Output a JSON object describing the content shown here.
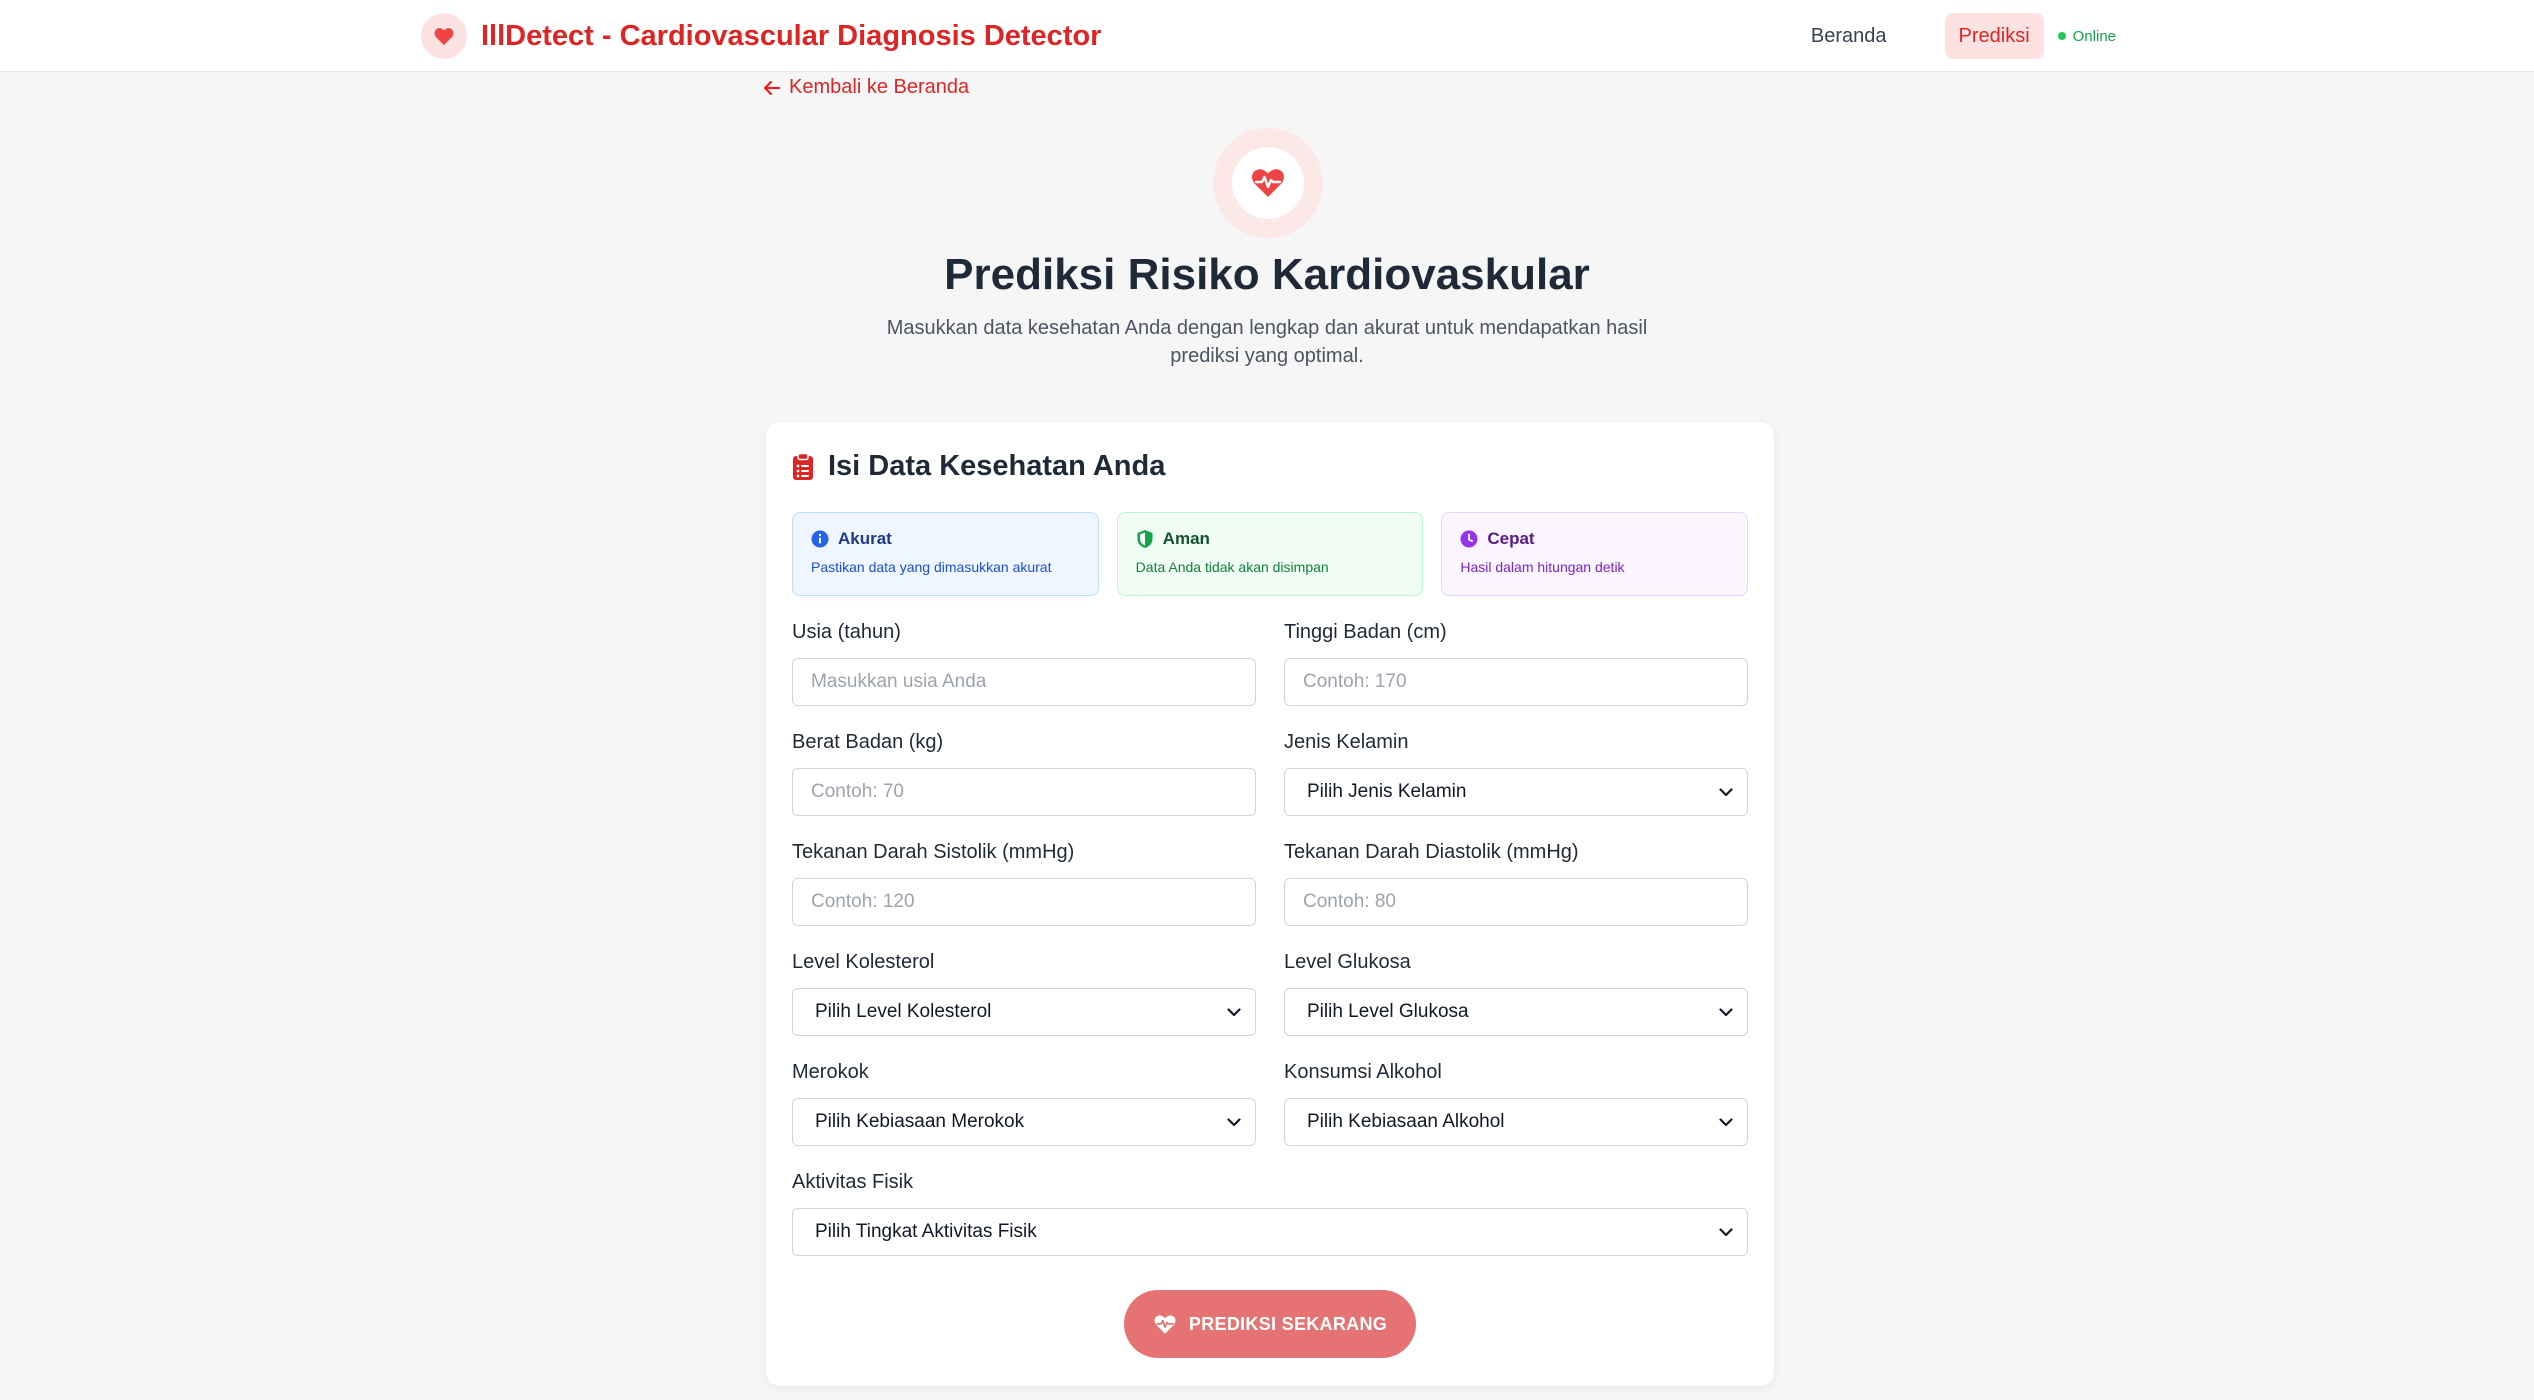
{
  "header": {
    "brand_title": "IllDetect - Cardiovascular Diagnosis Detector",
    "nav": {
      "home": "Beranda",
      "predict": "Prediksi",
      "status": "Online"
    }
  },
  "back_link": "Kembali ke Beranda",
  "hero": {
    "title": "Prediksi Risiko Kardiovaskular",
    "subtitle": "Masukkan data kesehatan Anda dengan lengkap dan akurat untuk mendapatkan hasil prediksi yang optimal."
  },
  "form": {
    "title": "Isi Data Kesehatan Anda",
    "info": [
      {
        "title": "Akurat",
        "desc": "Pastikan data yang dimasukkan akurat",
        "icon": "info-icon"
      },
      {
        "title": "Aman",
        "desc": "Data Anda tidak akan disimpan",
        "icon": "shield-icon"
      },
      {
        "title": "Cepat",
        "desc": "Hasil dalam hitungan detik",
        "icon": "clock-icon"
      }
    ],
    "fields": {
      "age": {
        "label": "Usia (tahun)",
        "placeholder": "Masukkan usia Anda"
      },
      "height": {
        "label": "Tinggi Badan (cm)",
        "placeholder": "Contoh: 170"
      },
      "weight": {
        "label": "Berat Badan (kg)",
        "placeholder": "Contoh: 70"
      },
      "gender": {
        "label": "Jenis Kelamin",
        "value": "Pilih Jenis Kelamin"
      },
      "systolic": {
        "label": "Tekanan Darah Sistolik (mmHg)",
        "placeholder": "Contoh: 120"
      },
      "diastolic": {
        "label": "Tekanan Darah Diastolik (mmHg)",
        "placeholder": "Contoh: 80"
      },
      "cholesterol": {
        "label": "Level Kolesterol",
        "value": "Pilih Level Kolesterol"
      },
      "glucose": {
        "label": "Level Glukosa",
        "value": "Pilih Level Glukosa"
      },
      "smoking": {
        "label": "Merokok",
        "value": "Pilih Kebiasaan Merokok"
      },
      "alcohol": {
        "label": "Konsumsi Alkohol",
        "value": "Pilih Kebiasaan Alkohol"
      },
      "activity": {
        "label": "Aktivitas Fisik",
        "value": "Pilih Tingkat Aktivitas Fisik"
      }
    },
    "submit_label": "PREDIKSI SEKARANG"
  },
  "colors": {
    "accent": "#dc2626",
    "button": "#e57373",
    "background": "#f6f6f7"
  }
}
